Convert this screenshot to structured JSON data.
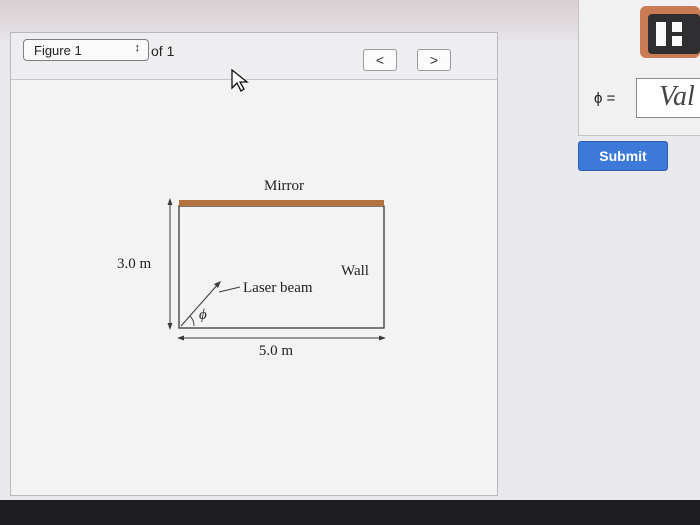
{
  "figure_viewer": {
    "select_value": "Figure 1",
    "of_label": "of 1",
    "prev_icon": "<",
    "next_icon": ">"
  },
  "diagram": {
    "mirror_label": "Mirror",
    "wall_label": "Wall",
    "laser_label": "Laser beam",
    "angle_label": "ϕ",
    "height_label": "3.0 m",
    "width_label": "5.0 m",
    "mirror_color": "#b5723c"
  },
  "answer": {
    "variable_label": "ϕ =",
    "input_placeholder": "Val"
  },
  "submit_label": "Submit",
  "colors": {
    "submit": "#3d79d8",
    "template_button": "#c97b55"
  }
}
